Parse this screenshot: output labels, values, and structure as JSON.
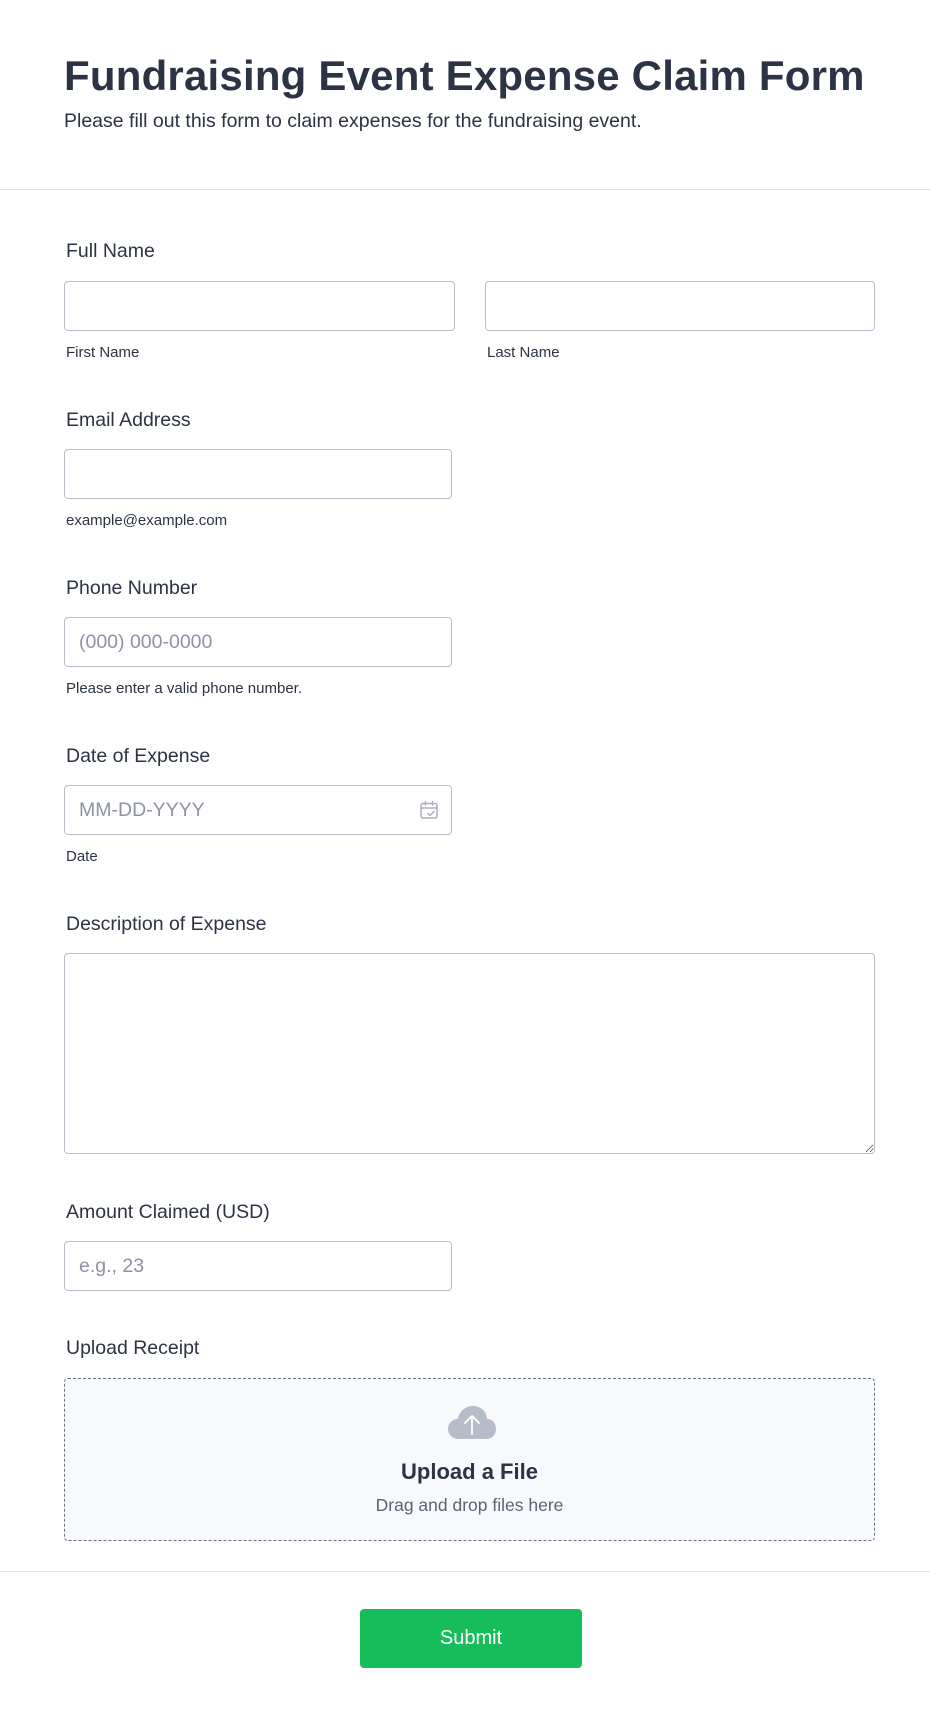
{
  "form": {
    "title": "Fundraising Event Expense Claim Form",
    "subtitle": "Please fill out this form to claim expenses for the fundraising event."
  },
  "fields": {
    "full_name": {
      "label": "Full Name",
      "first_sublabel": "First Name",
      "last_sublabel": "Last Name",
      "first_value": "",
      "last_value": ""
    },
    "email": {
      "label": "Email Address",
      "value": "",
      "sublabel": "example@example.com"
    },
    "phone": {
      "label": "Phone Number",
      "placeholder": "(000) 000-0000",
      "sublabel": "Please enter a valid phone number."
    },
    "date": {
      "label": "Date of Expense",
      "placeholder": "MM-DD-YYYY",
      "sublabel": "Date",
      "icon": "calendar-icon"
    },
    "description": {
      "label": "Description of Expense",
      "value": ""
    },
    "amount": {
      "label": "Amount Claimed (USD)",
      "placeholder": "e.g., 23"
    },
    "upload": {
      "label": "Upload Receipt",
      "title": "Upload a File",
      "subtitle": "Drag and drop files here",
      "icon": "cloud-upload-icon"
    }
  },
  "submit": {
    "label": "Submit",
    "color": "#18bd5b"
  },
  "colors": {
    "text": "#2c3345",
    "border": "#b8bdc9",
    "placeholder": "#8d93a5"
  }
}
